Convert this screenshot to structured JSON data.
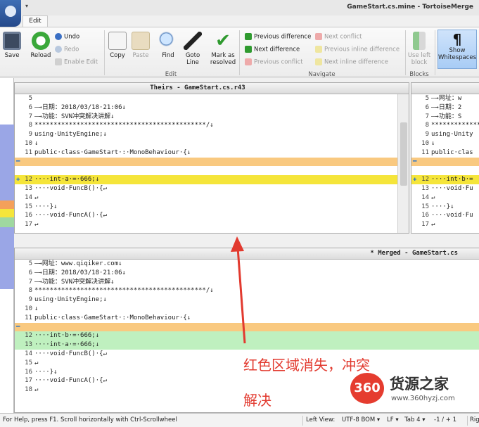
{
  "window": {
    "title": "GameStart.cs.mine - TortoiseMerge"
  },
  "ribbon": {
    "tab_label": "Edit",
    "buttons": {
      "save": "Save",
      "reload": "Reload",
      "undo": "Undo",
      "redo": "Redo",
      "enable_edit": "Enable Edit",
      "copy": "Copy",
      "paste": "Paste",
      "find": "Find",
      "goto_line": [
        "Goto",
        "Line"
      ],
      "mark_resolved": [
        "Mark as",
        "resolved"
      ],
      "prev_difference": "Previous difference",
      "next_difference": "Next difference",
      "prev_conflict": "Previous conflict",
      "next_conflict": "Next conflict",
      "prev_inline": "Previous inline difference",
      "next_inline": "Next inline difference",
      "use_left_block": [
        "Use left",
        "block"
      ],
      "show_whitespaces": [
        "Show",
        "Whitespaces"
      ]
    },
    "groups": {
      "edit": "Edit",
      "navigate": "Navigate",
      "blocks": "Blocks"
    }
  },
  "theirs": {
    "title": "Theirs - GameStart.cs.r43",
    "lines": [
      {
        "n": "5",
        "t": ""
      },
      {
        "n": "6",
        "t": "—→日期：2018/03/18·21:06↓"
      },
      {
        "n": "7",
        "t": "—→功能：SVN冲突解决讲解↓"
      },
      {
        "n": "8",
        "t": "*********************************************/↓"
      },
      {
        "n": "9",
        "t": "using·UnityEngine;↓"
      },
      {
        "n": "10",
        "t": "↓"
      },
      {
        "n": "11",
        "t": "public·class·GameStart·:·MonoBehaviour·{↓"
      },
      {
        "n": "",
        "t": ""
      },
      {
        "n": "",
        "t": ""
      },
      {
        "n": "12",
        "t": "····int·a·=·666;↓"
      },
      {
        "n": "13",
        "t": "····void·FuncB()·{↵"
      },
      {
        "n": "14",
        "t": "↵"
      },
      {
        "n": "15",
        "t": "····}↓"
      },
      {
        "n": "16",
        "t": "····void·FuncA()·{↵"
      },
      {
        "n": "17",
        "t": "↵"
      }
    ]
  },
  "mine": {
    "lines": [
      {
        "n": "5",
        "t": "—→网址：w"
      },
      {
        "n": "6",
        "t": "—→日期：2"
      },
      {
        "n": "7",
        "t": "—→功能：S"
      },
      {
        "n": "8",
        "t": "*************"
      },
      {
        "n": "9",
        "t": "using·Unity"
      },
      {
        "n": "10",
        "t": "↓"
      },
      {
        "n": "11",
        "t": "public·clas"
      },
      {
        "n": "",
        "t": ""
      },
      {
        "n": "",
        "t": ""
      },
      {
        "n": "12",
        "t": "····int·b·="
      },
      {
        "n": "13",
        "t": "····void·Fu"
      },
      {
        "n": "14",
        "t": "↵"
      },
      {
        "n": "15",
        "t": "····}↓"
      },
      {
        "n": "16",
        "t": "····void·Fu"
      },
      {
        "n": "17",
        "t": "↵"
      }
    ]
  },
  "merged": {
    "title": "* Merged - GameStart.cs",
    "lines": [
      {
        "n": "5",
        "t": "—→网址：www.qiqiker.com↓"
      },
      {
        "n": "6",
        "t": "—→日期：2018/03/18·21:06↓"
      },
      {
        "n": "7",
        "t": "—→功能：SVN冲突解决讲解↓"
      },
      {
        "n": "8",
        "t": "*********************************************/↓"
      },
      {
        "n": "9",
        "t": "using·UnityEngine;↓"
      },
      {
        "n": "10",
        "t": "↓"
      },
      {
        "n": "11",
        "t": "public·class·GameStart·:·MonoBehaviour·{↓"
      },
      {
        "n": "",
        "t": ""
      },
      {
        "n": "12",
        "t": "····int·b·=·666;↓"
      },
      {
        "n": "13",
        "t": "····int·a·=·666;↓"
      },
      {
        "n": "14",
        "t": "····void·FuncB()·{↵"
      },
      {
        "n": "15",
        "t": "↵"
      },
      {
        "n": "16",
        "t": "····}↓"
      },
      {
        "n": "17",
        "t": "····void·FuncA()·{↵"
      },
      {
        "n": "18",
        "t": "↵"
      }
    ]
  },
  "annotation": {
    "line1": "红色区域消失，冲突",
    "line2": "解决"
  },
  "watermark": {
    "badge": "360",
    "name": "货源之家",
    "url": "www.360hyzj.com"
  },
  "statusbar": {
    "help": "For Help, press F1. Scroll horizontally with Ctrl-Scrollwheel",
    "view": "Left View:",
    "encoding": "UTF-8 BOM",
    "eol": "LF",
    "tab": "Tab 4",
    "pos": "-1 / + 1",
    "right": "Rig"
  },
  "colors": {
    "conflict_orange": "#f9c980",
    "changed_yellow": "#f5e53a",
    "added_green": "#bff0bf",
    "annotation_red": "#e23a2f"
  }
}
